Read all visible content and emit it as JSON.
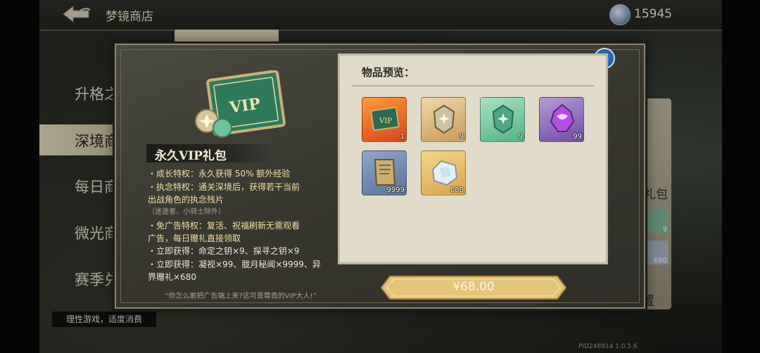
{
  "header": {
    "title": "梦镜商店",
    "currency_amount": "15945"
  },
  "sidebar": {
    "items": [
      {
        "label": "升格之"
      },
      {
        "label": "深境商"
      },
      {
        "label": "每日商"
      },
      {
        "label": "微光商"
      },
      {
        "label": "赛季兑"
      }
    ],
    "active_index": 1
  },
  "background_panel": {
    "pack_label": "礼包",
    "slot_counts": [
      "9",
      "680"
    ],
    "button_text": "置"
  },
  "footer": {
    "healthy_gaming_note": "理性游戏，适度消费",
    "pid": "PID248914  1.0.5.6"
  },
  "modal": {
    "pack_name": "永久VIP礼包",
    "description_lines": [
      "・成长特权：永久获得 50% 额外经验",
      "・执念特权：通关深境后，获得若干当前",
      "出战角色的执念残片",
      "（迷途者、小骑士除外）",
      "・免广告特权：复活、祝福刷新无需观看",
      "广告，每日赠礼直接领取",
      "・立即获得：命定之钥×9、探寻之钥×9",
      "・立即获得：凝视×99、胧月秘闻×9999、异",
      "界赠礼×680"
    ],
    "quote": "“你怎么敢把广告端上来?这可是尊贵的VIP大人!”",
    "preview_title": "物品预览：",
    "items": [
      {
        "icon": "vip-card-icon",
        "qty": "1"
      },
      {
        "icon": "destined-key-icon",
        "qty": "9"
      },
      {
        "icon": "explore-key-icon",
        "qty": "9"
      },
      {
        "icon": "gaze-crystal-icon",
        "qty": "99"
      },
      {
        "icon": "scroll-icon",
        "qty": "9999"
      },
      {
        "icon": "otherworld-gift-icon",
        "qty": "680"
      }
    ],
    "price": "¥68.00"
  },
  "colors": {
    "accent_gold": "#f1dfa6",
    "close_blue": "#2b66c0",
    "price_gold": "#e2c57a"
  }
}
